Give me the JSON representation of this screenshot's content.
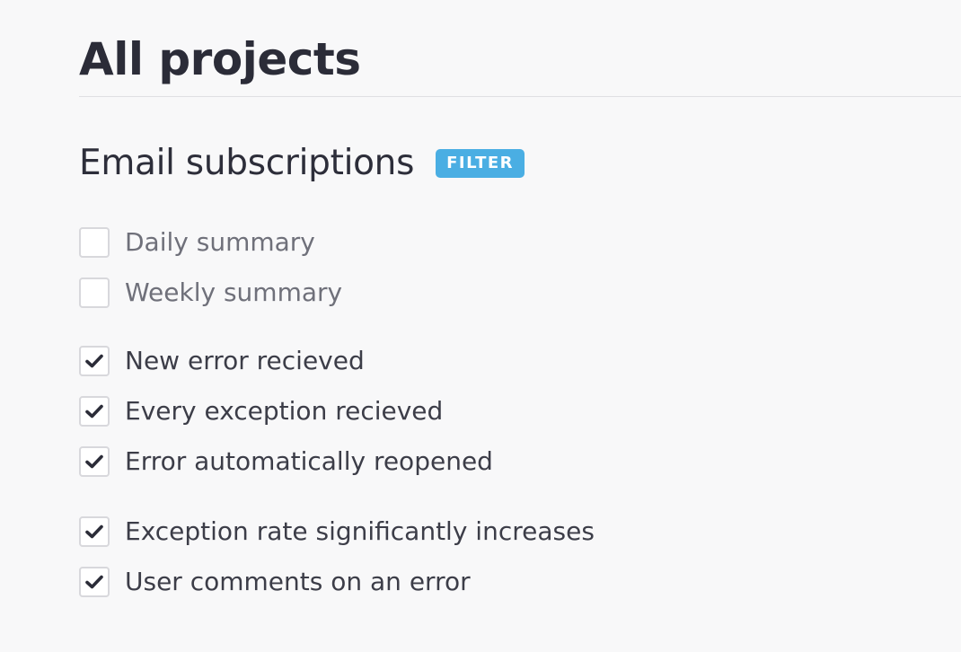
{
  "page": {
    "title": "All projects"
  },
  "section": {
    "title": "Email subscriptions",
    "filter_label": "FILTER"
  },
  "colors": {
    "accent": "#4aaee3",
    "checkmark": "#2b2c38",
    "background": "#f8f8f9"
  },
  "options": [
    {
      "label": "Daily summary",
      "checked": false
    },
    {
      "label": "Weekly summary",
      "checked": false
    },
    {
      "label": "New error recieved",
      "checked": true
    },
    {
      "label": "Every exception recieved",
      "checked": true
    },
    {
      "label": "Error automatically reopened",
      "checked": true
    },
    {
      "label": "Exception rate significantly increases",
      "checked": true
    },
    {
      "label": "User comments on an error",
      "checked": true
    }
  ]
}
